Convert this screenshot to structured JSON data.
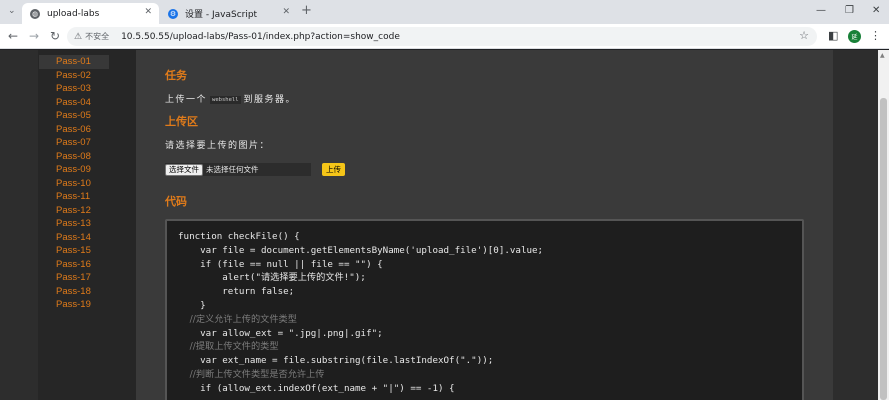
{
  "browser": {
    "tabs": [
      {
        "title": "upload-labs",
        "active": true
      },
      {
        "title": "设置 - JavaScript",
        "active": false
      }
    ],
    "address": {
      "security_label": "不安全",
      "url": "10.5.50.55/upload-labs/Pass-01/index.php?action=show_code"
    },
    "profile_label": "延"
  },
  "sidebar": {
    "items": [
      "Pass-01",
      "Pass-02",
      "Pass-03",
      "Pass-04",
      "Pass-05",
      "Pass-06",
      "Pass-07",
      "Pass-08",
      "Pass-09",
      "Pass-10",
      "Pass-11",
      "Pass-12",
      "Pass-13",
      "Pass-14",
      "Pass-15",
      "Pass-16",
      "Pass-17",
      "Pass-18",
      "Pass-19"
    ],
    "selected": 0
  },
  "content": {
    "task_heading": "任务",
    "task_text_before": "上传一个",
    "task_code": "webshell",
    "task_text_after": "到服务器。",
    "upload_heading": "上传区",
    "upload_prompt": "请选择要上传的图片：",
    "file_button": "选择文件",
    "file_status": "未选择任何文件",
    "upload_button": "上传",
    "code_heading": "代码",
    "code_lines": [
      {
        "text": "function checkFile() {",
        "comment": false
      },
      {
        "text": "    var file = document.getElementsByName('upload_file')[0].value;",
        "comment": false
      },
      {
        "text": "    if (file == null || file == \"\") {",
        "comment": false
      },
      {
        "text": "        alert(\"请选择要上传的文件!\");",
        "comment": false
      },
      {
        "text": "        return false;",
        "comment": false
      },
      {
        "text": "    }",
        "comment": false
      },
      {
        "text": "    //定义允许上传的文件类型",
        "comment": true
      },
      {
        "text": "    var allow_ext = \".jpg|.png|.gif\";",
        "comment": false
      },
      {
        "text": "    //提取上传文件的类型",
        "comment": true
      },
      {
        "text": "    var ext_name = file.substring(file.lastIndexOf(\".\"));",
        "comment": false
      },
      {
        "text": "    //判断上传文件类型是否允许上传",
        "comment": true
      },
      {
        "text": "    if (allow_ext.indexOf(ext_name + \"|\") == -1) {",
        "comment": false
      }
    ]
  },
  "colors": {
    "accent": "#e07b1a",
    "upload_button": "#f5c518",
    "code_background": "#1e1e1e"
  }
}
